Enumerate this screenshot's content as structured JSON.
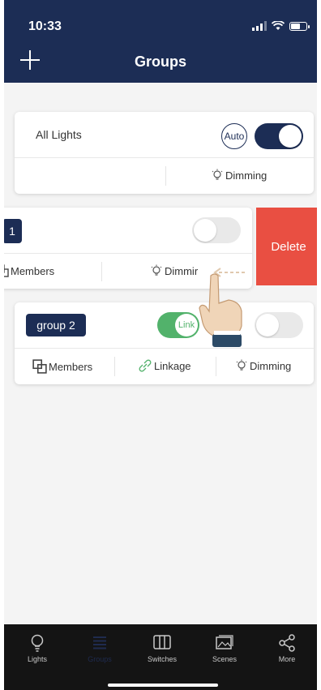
{
  "status_bar": {
    "time": "10:33"
  },
  "header": {
    "title": "Groups"
  },
  "cards": [
    {
      "name": "All Lights",
      "auto_label": "Auto",
      "toggle_on": true,
      "dimming_label": "Dimming"
    },
    {
      "tag": "1",
      "toggle_on": false,
      "members_label": "Members",
      "dimming_label": "Dimmir",
      "delete_label": "Delete"
    },
    {
      "tag": "group 2",
      "link_label": "Link",
      "toggle_on": false,
      "members_label": "Members",
      "linkage_label": "Linkage",
      "dimming_label": "Dimming"
    }
  ],
  "tabbar": {
    "items": [
      {
        "label": "Lights",
        "icon": "bulb-icon"
      },
      {
        "label": "Groups",
        "icon": "list-icon",
        "active": true
      },
      {
        "label": "Switches",
        "icon": "switch-icon"
      },
      {
        "label": "Scenes",
        "icon": "picture-icon"
      },
      {
        "label": "More",
        "icon": "share-icon"
      }
    ]
  },
  "colors": {
    "header_bg": "#1c2d55",
    "accent": "#1c2d55",
    "delete": "#e94f42",
    "link_on": "#52b26b",
    "tabbar_bg": "#141414"
  }
}
